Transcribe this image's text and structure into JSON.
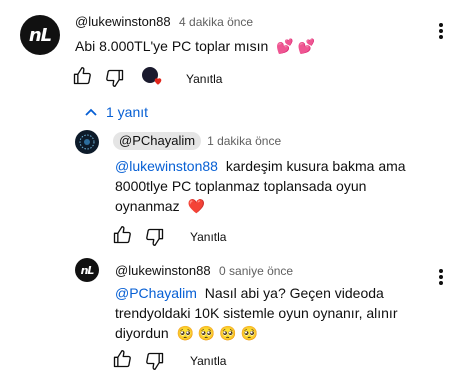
{
  "comment": {
    "author": "@lukewinston88",
    "time": "4 dakika önce",
    "text": "Abi 8.000TL'ye PC toplar mısın",
    "emoji": "💕 💕",
    "avatar_initials": "nL",
    "reply_label": "Yanıtla",
    "heart_icon": "creator-heart-icon"
  },
  "replies_toggle": {
    "label": "1 yanıt",
    "icon": "chevron-up-icon"
  },
  "reply1": {
    "author": "@PChayalim",
    "time": "1 dakika önce",
    "mention": "@lukewinston88",
    "line1": "kardeşim kusura bakma ama",
    "line2": "8000tlye PC toplanmaz toplansada oyun",
    "line3": "oynanmaz",
    "emoji": "❤️",
    "reply_label": "Yanıtla"
  },
  "reply2": {
    "author": "@lukewinston88",
    "time": "0 saniye önce",
    "mention": "@PChayalim",
    "line1": "Nasıl abi ya? Geçen videoda",
    "line2": "trendyoldaki 10K sistemle oyun oynanır, alınır",
    "line3": "diyordun",
    "emoji": "🥺 🥺 🥺 🥺",
    "avatar_initials": "nL",
    "reply_label": "Yanıtla"
  },
  "colors": {
    "link": "#065fd4",
    "secondary": "#606060",
    "chip": "#e5e5e5"
  }
}
